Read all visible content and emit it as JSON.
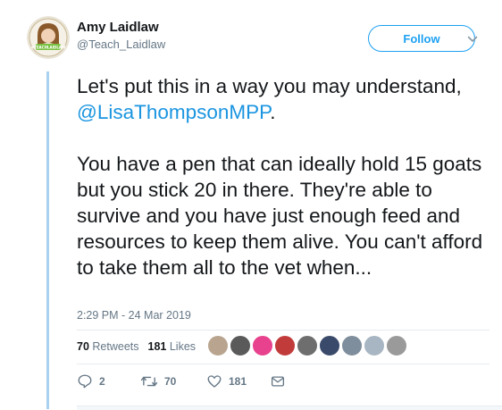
{
  "author": {
    "display_name": "Amy Laidlaw",
    "handle": "@Teach_Laidlaw",
    "avatar_badge": "#TEACHLAIDLAW"
  },
  "follow_label": "Follow",
  "tweet": {
    "line1_prefix": "Let's put this in a way you may understand, ",
    "mention": "@LisaThompsonMPP",
    "line1_suffix": ".",
    "paragraph2": "You have a pen that can ideally hold 15 goats but you stick 20 in there. They're able to survive and you have just enough feed and resources to keep them alive. You can't afford to take them all to the vet when..."
  },
  "timestamp": "2:29 PM - 24 Mar 2019",
  "stats": {
    "retweets_count": "70",
    "retweets_label": "Retweets",
    "likes_count": "181",
    "likes_label": "Likes"
  },
  "liker_colors": [
    "#b9a58f",
    "#5a5a5a",
    "#e8418d",
    "#c23b3b",
    "#6e6e6e",
    "#3a4a6b",
    "#7f8e9c",
    "#a7b6c2",
    "#9a9a9a"
  ],
  "actions": {
    "reply_count": "2",
    "retweet_count": "70",
    "like_count": "181"
  },
  "colors": {
    "accent": "#1da1f2",
    "mention": "#1b95e0",
    "thread_line": "#a8d2ef",
    "muted": "#657786"
  }
}
